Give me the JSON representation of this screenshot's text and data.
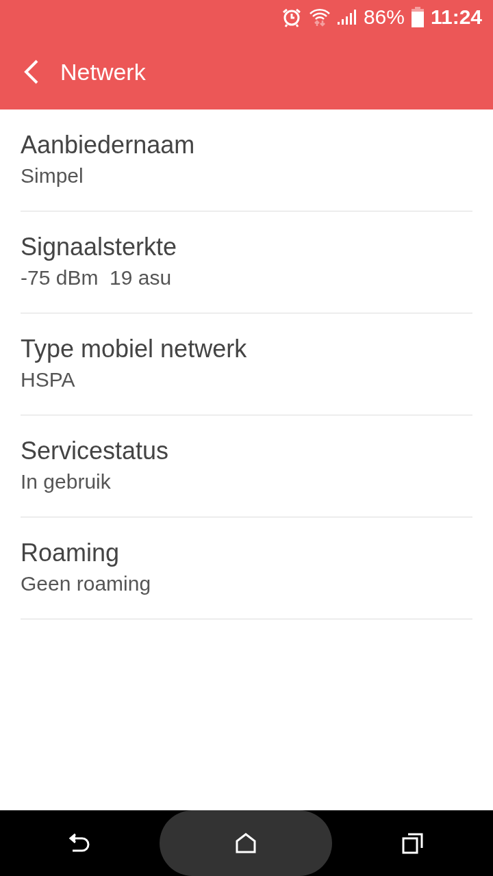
{
  "status_bar": {
    "battery": "86%",
    "time": "11:24"
  },
  "app_bar": {
    "title": "Netwerk"
  },
  "items": [
    {
      "title": "Aanbiedernaam",
      "value": "Simpel"
    },
    {
      "title": "Signaalsterkte",
      "value": "-75 dBm  19 asu"
    },
    {
      "title": "Type mobiel netwerk",
      "value": "HSPA"
    },
    {
      "title": "Servicestatus",
      "value": "In gebruik"
    },
    {
      "title": "Roaming",
      "value": "Geen roaming"
    }
  ]
}
